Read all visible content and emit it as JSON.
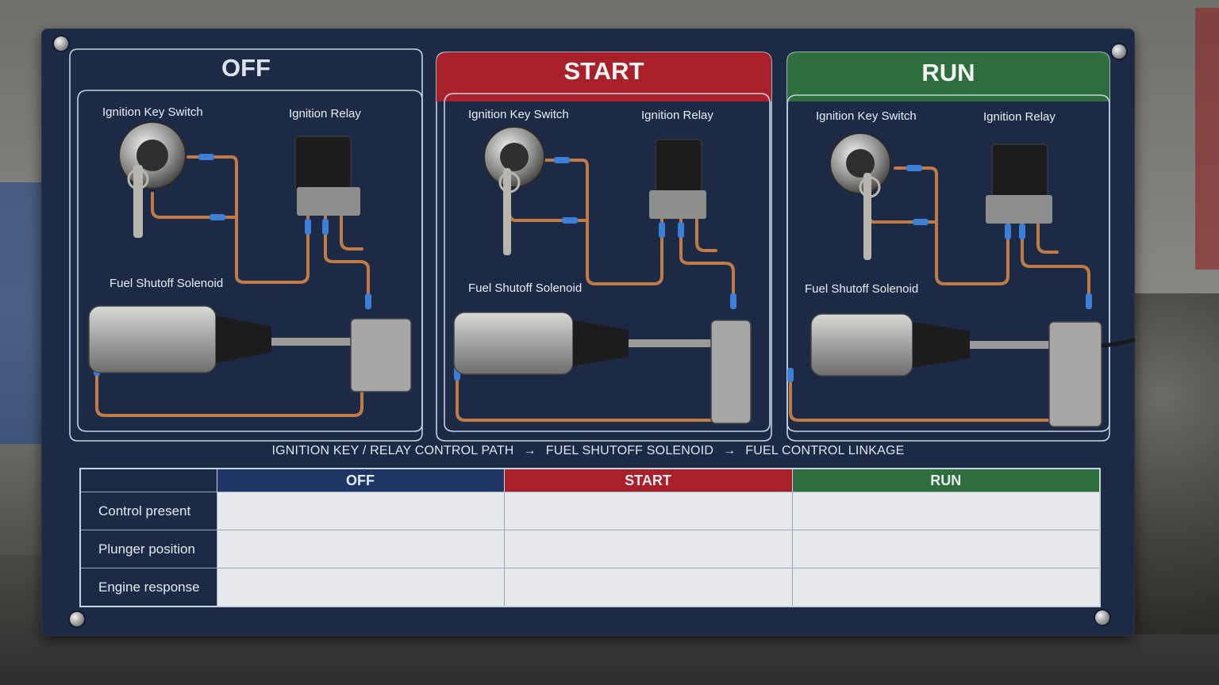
{
  "panels": [
    {
      "id": "off",
      "header": "OFF",
      "header_color": "#1c2a45",
      "key_label": "Ignition Key Switch",
      "relay_label": "Ignition Relay",
      "solenoid_label": "Fuel Shutoff Solenoid"
    },
    {
      "id": "start",
      "header": "START",
      "header_color": "#a8212a",
      "key_label": "Ignition Key Switch",
      "relay_label": "Ignition Relay",
      "solenoid_label": "Fuel Shutoff Solenoid"
    },
    {
      "id": "run",
      "header": "RUN",
      "header_color": "#2e6e3c",
      "key_label": "Ignition Key Switch",
      "relay_label": "Ignition Relay",
      "solenoid_label": "Fuel Shutoff Solenoid"
    }
  ],
  "flow": {
    "step1": "IGNITION KEY / RELAY CONTROL PATH",
    "step2": "FUEL SHUTOFF SOLENOID",
    "step3": "FUEL CONTROL LINKAGE",
    "arrow": "→"
  },
  "table": {
    "columns": [
      "OFF",
      "START",
      "RUN"
    ],
    "column_colors": [
      "#1e3566",
      "#a8212a",
      "#2e6e3c"
    ],
    "rows": [
      "Control present",
      "Plunger position",
      "Engine response"
    ]
  },
  "colors": {
    "board": "#1c2a45",
    "wire": "#c07a45",
    "connector": "#3c7fd6"
  }
}
